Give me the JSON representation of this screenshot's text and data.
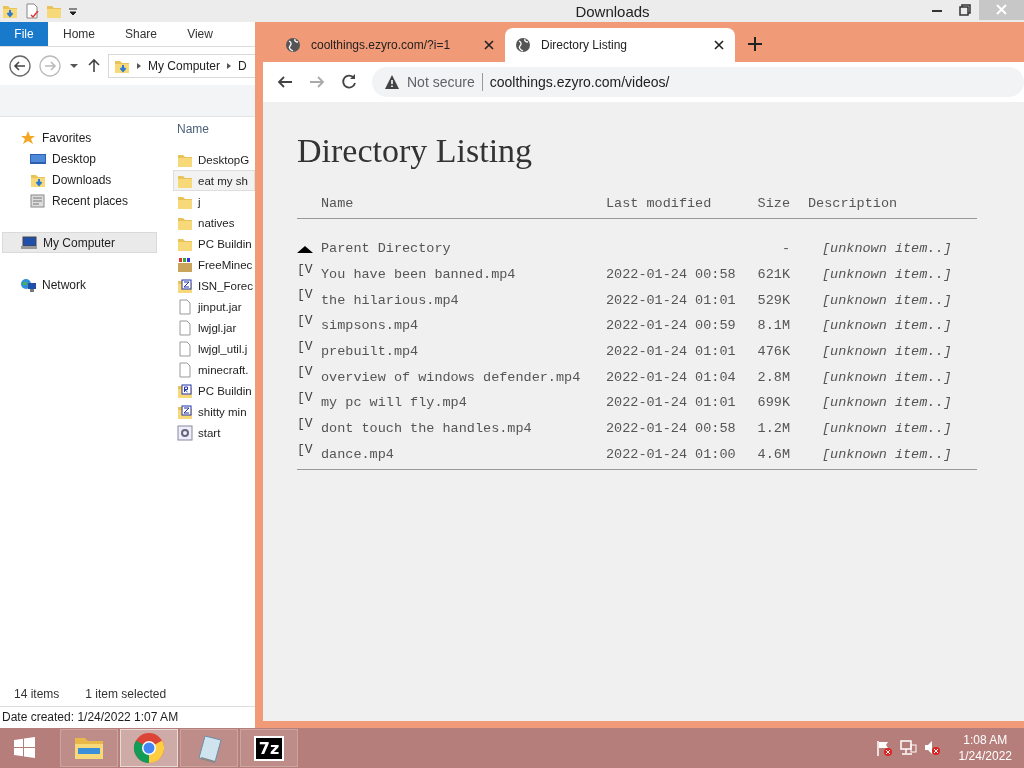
{
  "explorer": {
    "title": "Downloads",
    "ribbon_tabs": [
      {
        "label": "File",
        "selected": true
      },
      {
        "label": "Home",
        "selected": false
      },
      {
        "label": "Share",
        "selected": false
      },
      {
        "label": "View",
        "selected": false
      }
    ],
    "address": [
      "My Computer",
      "D"
    ],
    "nav_pane": [
      {
        "label": "Favorites",
        "kind": "star",
        "selected": false,
        "children": [
          {
            "label": "Desktop",
            "kind": "desktop",
            "selected": false
          },
          {
            "label": "Downloads",
            "kind": "downloads",
            "selected": false
          },
          {
            "label": "Recent places",
            "kind": "recent",
            "selected": false
          }
        ]
      },
      {
        "label": "My Computer",
        "kind": "computer",
        "selected": true
      },
      {
        "label": "Network",
        "kind": "network",
        "selected": false
      }
    ],
    "column": "Name",
    "files": [
      {
        "name": "DesktopG",
        "kind": "folder",
        "selected": false
      },
      {
        "name": "eat my sh",
        "kind": "folder",
        "selected": true
      },
      {
        "name": "j",
        "kind": "folder",
        "selected": false
      },
      {
        "name": "natives",
        "kind": "folder",
        "selected": false
      },
      {
        "name": "PC Buildin",
        "kind": "folder",
        "selected": false
      },
      {
        "name": "FreeMinec",
        "kind": "installer",
        "selected": false
      },
      {
        "name": "ISN_Forec",
        "kind": "zip",
        "selected": false
      },
      {
        "name": "jinput.jar",
        "kind": "file",
        "selected": false
      },
      {
        "name": "lwjgl.jar",
        "kind": "file",
        "selected": false
      },
      {
        "name": "lwjgl_util.j",
        "kind": "file",
        "selected": false
      },
      {
        "name": "minecraft.",
        "kind": "file",
        "selected": false
      },
      {
        "name": "PC Buildin",
        "kind": "rar",
        "selected": false
      },
      {
        "name": "shitty min",
        "kind": "zip",
        "selected": false
      },
      {
        "name": "start",
        "kind": "settings",
        "selected": false
      }
    ],
    "status": {
      "count": "14 items",
      "selection": "1 item selected"
    },
    "details": "Date created: 1/24/2022 1:07 AM"
  },
  "browser": {
    "tabs": [
      {
        "title": "coolthings.ezyro.com/?i=1",
        "selected": false
      },
      {
        "title": "Directory Listing",
        "selected": true
      }
    ],
    "security": "Not secure",
    "url": "coolthings.ezyro.com/videos/",
    "page": {
      "heading": "Directory Listing",
      "columns": [
        "Name",
        "Last modified",
        "Size",
        "Description"
      ],
      "rows": [
        {
          "kind": "parent",
          "name": "Parent Directory",
          "modified": "",
          "size": "-",
          "description": "[unknown item..]"
        },
        {
          "kind": "video",
          "icon": "[V",
          "name": "You have been banned.mp4",
          "modified": "2022-01-24 00:58",
          "size": "621K",
          "description": "[unknown item..]"
        },
        {
          "kind": "video",
          "icon": "[V",
          "name": "the hilarious.mp4",
          "modified": "2022-01-24 01:01",
          "size": "529K",
          "description": "[unknown item..]"
        },
        {
          "kind": "video",
          "icon": "[V",
          "name": "simpsons.mp4",
          "modified": "2022-01-24 00:59",
          "size": "8.1M",
          "description": "[unknown item..]"
        },
        {
          "kind": "video",
          "icon": "[V",
          "name": "prebuilt.mp4",
          "modified": "2022-01-24 01:01",
          "size": "476K",
          "description": "[unknown item..]"
        },
        {
          "kind": "video",
          "icon": "[V",
          "name": "overview of windows defender.mp4",
          "modified": "2022-01-24 01:04",
          "size": "2.8M",
          "description": "[unknown item..]"
        },
        {
          "kind": "video",
          "icon": "[V",
          "name": "my pc will fly.mp4",
          "modified": "2022-01-24 01:01",
          "size": "699K",
          "description": "[unknown item..]"
        },
        {
          "kind": "video",
          "icon": "[V",
          "name": "dont touch the handles.mp4",
          "modified": "2022-01-24 00:58",
          "size": "1.2M",
          "description": "[unknown item..]"
        },
        {
          "kind": "video",
          "icon": "[V",
          "name": "dance.mp4",
          "modified": "2022-01-24 01:00",
          "size": "4.6M",
          "description": "[unknown item..]"
        }
      ]
    }
  },
  "taskbar": {
    "apps": [
      {
        "kind": "explorer",
        "selected": false
      },
      {
        "kind": "chrome",
        "selected": true
      },
      {
        "kind": "notepad",
        "selected": false
      },
      {
        "kind": "archiver",
        "label": "7z",
        "selected": false
      }
    ],
    "time": "1:08 AM",
    "date": "1/24/2022"
  }
}
